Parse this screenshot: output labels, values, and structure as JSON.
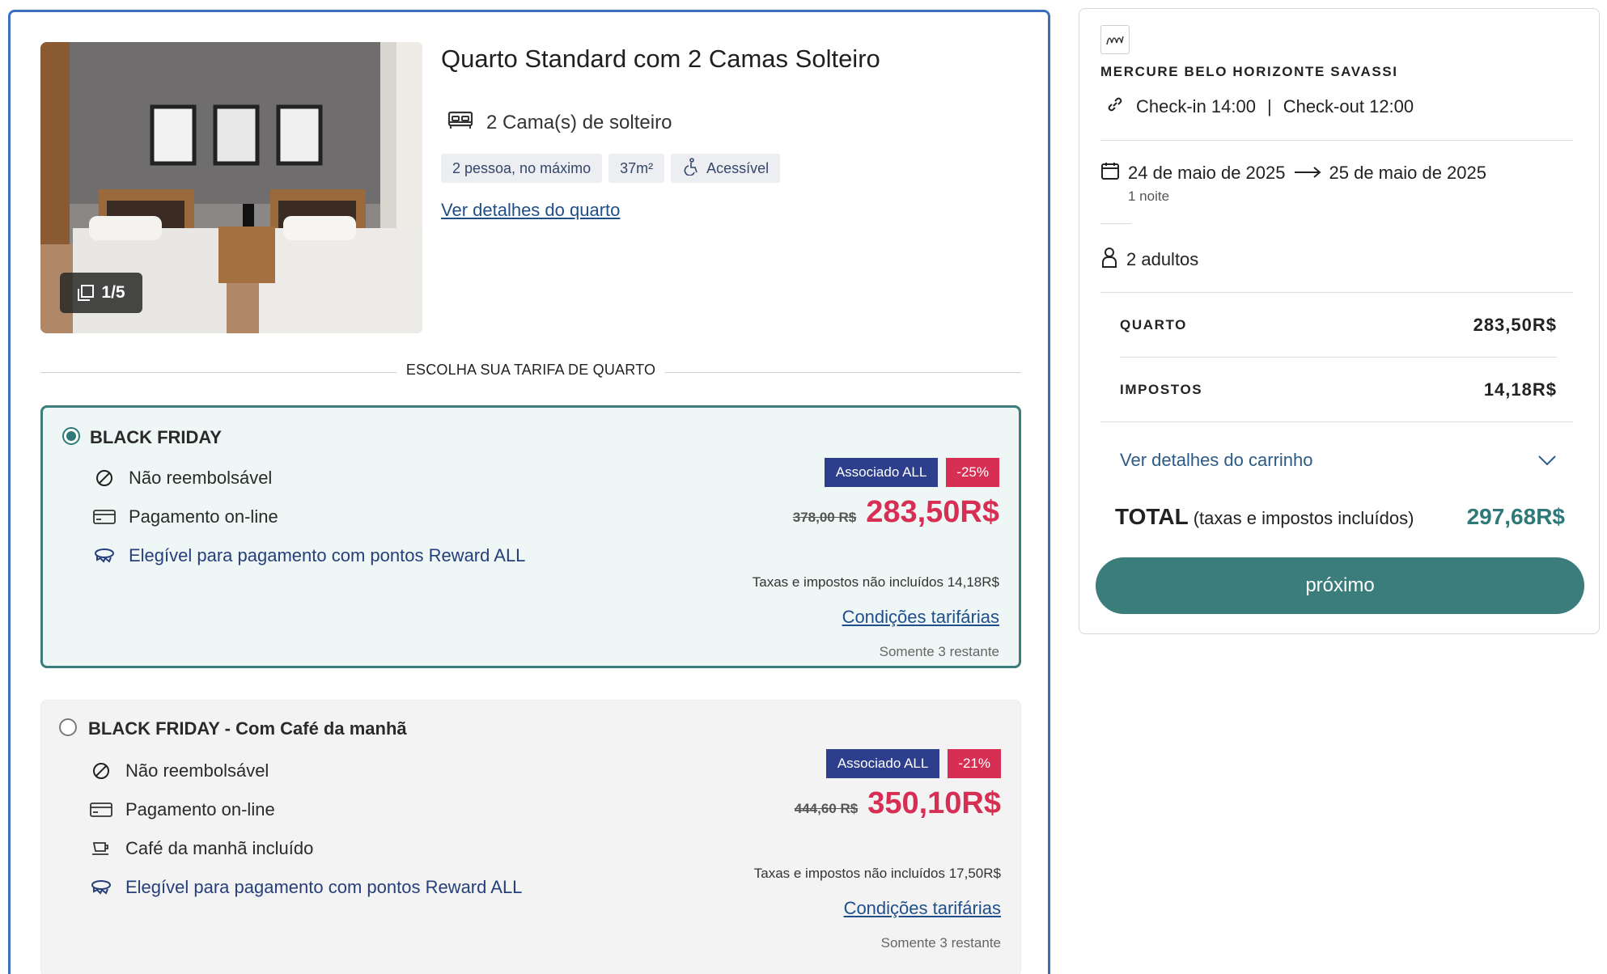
{
  "room": {
    "title": "Quarto Standard com 2 Camas Solteiro",
    "photo_counter": "1/5",
    "bed_info": "2 Cama(s) de solteiro",
    "chips": {
      "capacity": "2 pessoa, no máximo",
      "size": "37m²",
      "accessible": "Acessível"
    },
    "details_link": "Ver detalhes do quarto"
  },
  "section_label": "ESCOLHA SUA TARIFA DE QUARTO",
  "rates": [
    {
      "name": "BLACK FRIDAY",
      "selected": true,
      "features": {
        "refund": "Não reembolsável",
        "payment": "Pagamento on-line",
        "reward": "Elegível para pagamento com pontos Reward ALL"
      },
      "badge_assoc": "Associado ALL",
      "badge_discount": "-25%",
      "old_price": "378,00 R$",
      "new_price": "283,50R$",
      "taxes_note": "Taxas e impostos não incluídos 14,18R$",
      "conditions_link": "Condições tarifárias",
      "remaining": "Somente 3 restante"
    },
    {
      "name": "BLACK FRIDAY - Com Café da manhã",
      "selected": false,
      "features": {
        "refund": "Não reembolsável",
        "payment": "Pagamento on-line",
        "breakfast": "Café da manhã incluído",
        "reward": "Elegível para pagamento com pontos Reward ALL"
      },
      "badge_assoc": "Associado ALL",
      "badge_discount": "-21%",
      "old_price": "444,60 R$",
      "new_price": "350,10R$",
      "taxes_note": "Taxas e impostos não incluídos 17,50R$",
      "conditions_link": "Condições tarifárias",
      "remaining": "Somente 3 restante"
    }
  ],
  "sidebar": {
    "hotel_name": "MERCURE BELO HORIZONTE SAVASSI",
    "checkin": "Check-in 14:00",
    "divider": "|",
    "checkout": "Check-out 12:00",
    "date_from": "24 de maio de 2025",
    "date_to": "25 de maio de 2025",
    "nights": "1 noite",
    "guests": "2 adultos",
    "room_label": "QUARTO",
    "room_value": "283,50R$",
    "taxes_label": "IMPOSTOS",
    "taxes_value": "14,18R$",
    "cart_details": "Ver detalhes do carrinho",
    "total_label": "TOTAL",
    "total_sub": "(taxas e impostos incluídos)",
    "total_value": "297,68R$",
    "next_button": "próximo"
  },
  "colors": {
    "accent_teal": "#3a7d7b",
    "price_red": "#d72e54",
    "badge_blue": "#2c3e8c",
    "card_border": "#3d6fbf"
  },
  "icons": [
    "bed-icon",
    "accessible-icon",
    "gallery-icon",
    "no-refund-icon",
    "card-icon",
    "reward-icon",
    "coffee-icon",
    "link-icon",
    "calendar-icon",
    "arrow-right-icon",
    "person-icon",
    "chevron-down-icon",
    "brand-logo-icon"
  ]
}
